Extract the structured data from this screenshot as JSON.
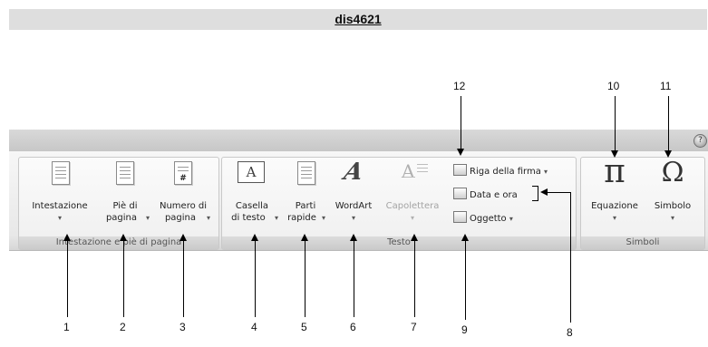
{
  "header": {
    "title": "dis4621"
  },
  "ribbon": {
    "groups": [
      {
        "label": "Intestazione e piè di pagina",
        "buttons": [
          {
            "label_1": "Intestazione",
            "label_2": "",
            "icon": "document-icon"
          },
          {
            "label_1": "Piè di",
            "label_2": "pagina",
            "icon": "document-icon"
          },
          {
            "label_1": "Numero di",
            "label_2": "pagina",
            "icon": "page-number-icon",
            "icon_text": "#"
          }
        ]
      },
      {
        "label": "Testo",
        "buttons": [
          {
            "label_1": "Casella",
            "label_2": "di testo",
            "icon": "textbox-icon",
            "icon_text": "A"
          },
          {
            "label_1": "Parti",
            "label_2": "rapide",
            "icon": "quick-parts-icon"
          },
          {
            "label_1": "WordArt",
            "label_2": "",
            "icon": "wordart-icon",
            "icon_text": "A"
          },
          {
            "label_1": "Capolettera",
            "label_2": "",
            "icon": "dropcap-icon",
            "icon_text": "A",
            "disabled": true
          }
        ],
        "small_buttons": [
          {
            "label": "Riga della firma",
            "icon": "signature-line-icon",
            "dropdown": true
          },
          {
            "label": "Data e ora",
            "icon": "date-time-icon",
            "dropdown": false
          },
          {
            "label": "Oggetto",
            "icon": "object-icon",
            "dropdown": true
          }
        ]
      },
      {
        "label": "Simboli",
        "buttons": [
          {
            "label_1": "Equazione",
            "label_2": "",
            "icon": "equation-icon",
            "icon_text": "π"
          },
          {
            "label_1": "Simbolo",
            "label_2": "",
            "icon": "symbol-icon",
            "icon_text": "Ω"
          }
        ]
      }
    ],
    "dropdown_glyph": "▾",
    "help_glyph": "?"
  },
  "callouts": {
    "n1": "1",
    "n2": "2",
    "n3": "3",
    "n4": "4",
    "n5": "5",
    "n6": "6",
    "n7": "7",
    "n8": "8",
    "n9": "9",
    "n10": "10",
    "n11": "11",
    "n12": "12"
  }
}
